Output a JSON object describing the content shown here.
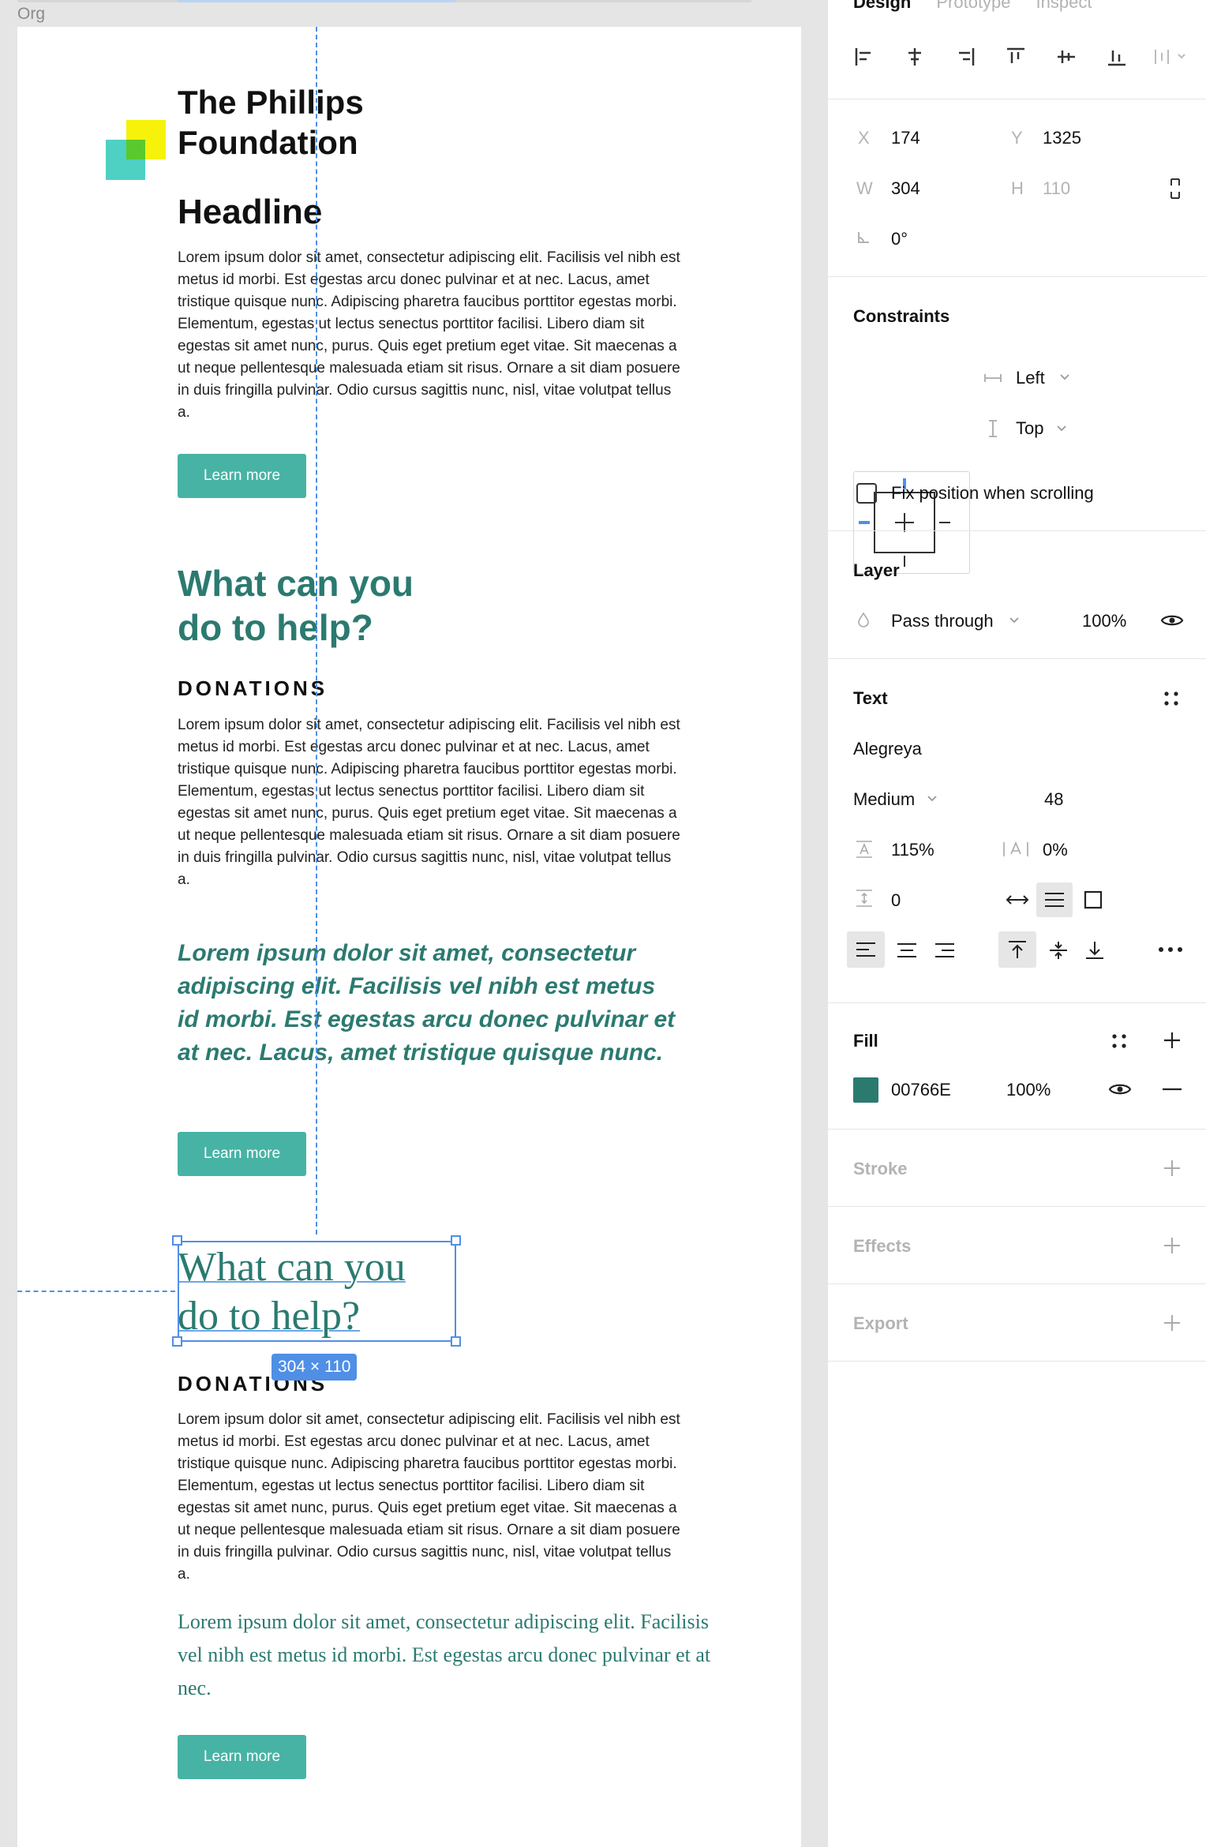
{
  "canvas": {
    "frame_label": "Org",
    "org_name_line1": "The Phillips",
    "org_name_line2": "Foundation",
    "headline": "Headline",
    "lorem": "Lorem ipsum dolor sit amet, consectetur adipiscing elit. Facilisis vel nibh est metus id morbi. Est egestas arcu donec pulvinar et at nec. Lacus, amet tristique quisque nunc. Adipiscing pharetra faucibus porttitor egestas morbi. Elementum, egestas ut lectus senectus porttitor facilisi. Libero diam sit egestas sit amet nunc, purus. Quis eget pretium eget vitae. Sit maecenas a ut neque pellentesque malesuada etiam sit risus. Ornare a sit diam posuere in duis fringilla pulvinar. Odio cursus sagittis nunc, nisl, vitae volutpat tellus a.",
    "button_label": "Learn more",
    "help_line1": "What can you",
    "help_line2": "do to help?",
    "donations": "DONATIONS",
    "quote": "Lorem ipsum dolor sit amet, consectetur adipiscing elit. Facilisis vel nibh est metus id morbi. Est egestas arcu donec pulvinar et at nec. Lacus, amet tristique quisque nunc.",
    "serif_paragraph": "Lorem ipsum dolor sit amet, consectetur adipiscing elit. Facilisis vel nibh est metus id morbi. Est egestas arcu donec pulvinar et at nec.",
    "selection_size": "304 × 110"
  },
  "panel": {
    "tabs": [
      "Design",
      "Prototype",
      "Inspect"
    ],
    "x_label": "X",
    "x_value": "174",
    "y_label": "Y",
    "y_value": "1325",
    "w_label": "W",
    "w_value": "304",
    "h_label": "H",
    "h_value": "110",
    "rotation": "0°",
    "constraints_title": "Constraints",
    "constraint_h": "Left",
    "constraint_v": "Top",
    "fix_position": "Fix position when scrolling",
    "layer_title": "Layer",
    "blend_mode": "Pass through",
    "layer_opacity": "100%",
    "text_title": "Text",
    "font_family": "Alegreya",
    "font_weight": "Medium",
    "font_size": "48",
    "line_height": "115%",
    "letter_spacing": "0%",
    "paragraph_spacing": "0",
    "fill_title": "Fill",
    "fill_hex": "00766E",
    "fill_opacity": "100%",
    "fill_color": "#2b7a70",
    "stroke_title": "Stroke",
    "effects_title": "Effects",
    "export_title": "Export"
  }
}
